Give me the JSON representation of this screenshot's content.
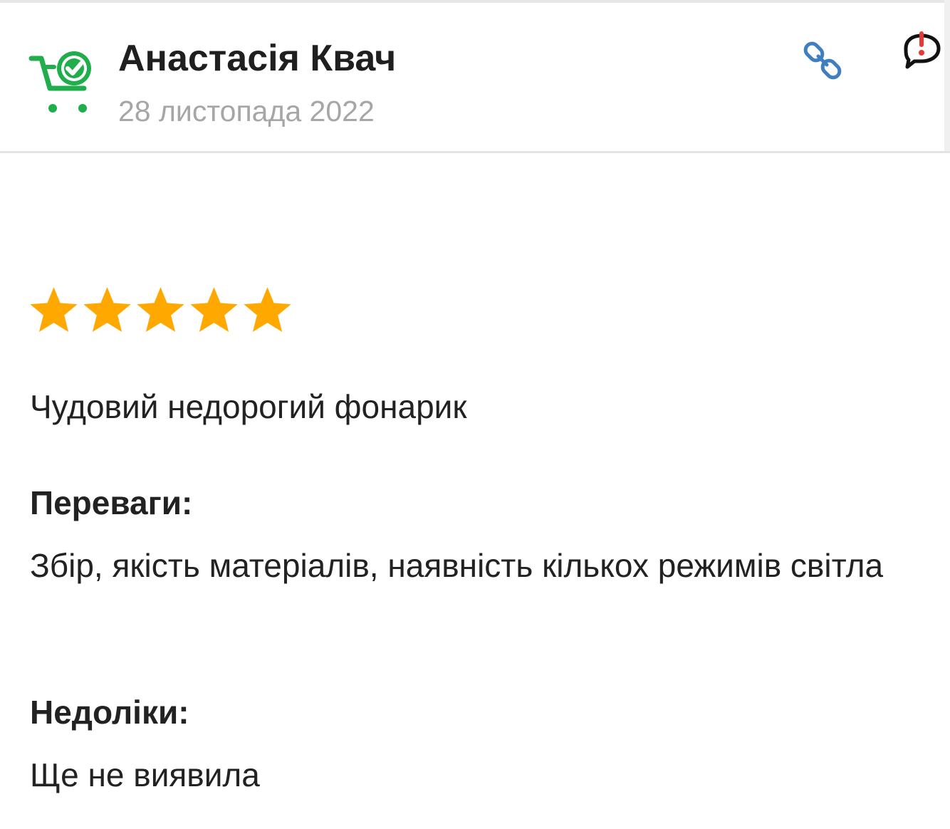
{
  "review": {
    "author": "Анастасія Квач",
    "date": "28 листопада 2022",
    "rating": 5,
    "rating_max": 5,
    "text": "Чудовий недорогий фонарик",
    "pros_title": "Переваги:",
    "pros": "Збір, якість матеріалів, наявність кількох режимів світла",
    "cons_title": "Недоліки:",
    "cons": "Ще не виявила"
  },
  "icons": {
    "avatar": "verified-buyer-cart-icon",
    "link": "link-icon",
    "report": "report-comment-icon"
  },
  "colors": {
    "avatar_green": "#1fae4b",
    "star": "#ffa900",
    "link_blue": "#3f7fbf",
    "report_red": "#e53935",
    "date_gray": "#a6a6a6"
  }
}
